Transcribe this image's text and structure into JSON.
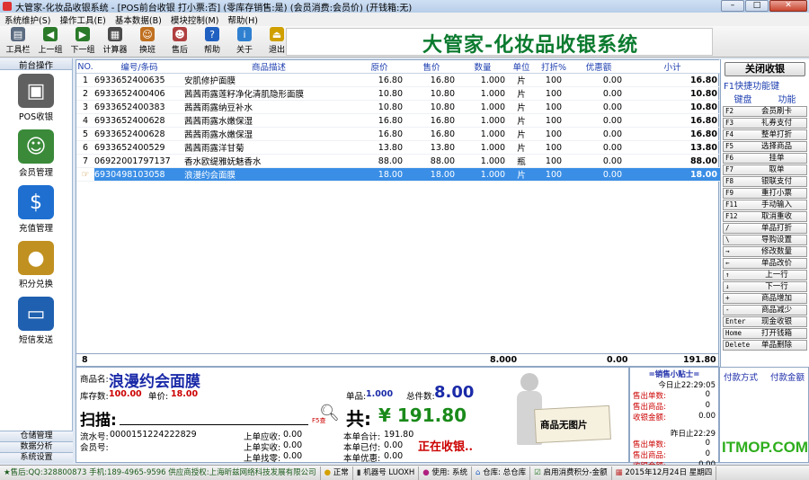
{
  "window": {
    "title": "大管家-化妆品收银系统 - [POS前台收银 打小票:否] (零库存销售:是) (会员消费:会员价) (开钱箱:无)",
    "min": "–",
    "max": "□",
    "close": "✕"
  },
  "menu": [
    "系统维护(S)",
    "操作工具(E)",
    "基本数据(B)",
    "模块控制(M)",
    "帮助(H)"
  ],
  "toolbar": {
    "buttons": [
      {
        "label": "工具栏",
        "icon": "toolbar-icon",
        "color": "#5b6b80"
      },
      {
        "label": "上一组",
        "icon": "left-arrow-icon",
        "color": "#2a7a2a"
      },
      {
        "label": "下一组",
        "icon": "right-arrow-icon",
        "color": "#2a7a2a"
      },
      {
        "label": "计算器",
        "icon": "calculator-icon",
        "color": "#4a4a4a"
      },
      {
        "label": "换班",
        "icon": "shift-icon",
        "color": "#c07020"
      },
      {
        "label": "售后",
        "icon": "service-icon",
        "color": "#b04040"
      },
      {
        "label": "帮助",
        "icon": "help-icon",
        "color": "#2060c0"
      },
      {
        "label": "关于",
        "icon": "about-icon",
        "color": "#3080d0"
      },
      {
        "label": "退出",
        "icon": "exit-icon",
        "color": "#d0a000"
      }
    ],
    "brand": "大管家-化妆品收银系统"
  },
  "leftnav": {
    "header": "前台操作",
    "items": [
      {
        "label": "POS收银",
        "icon": "pos-register-icon",
        "color": "#606060"
      },
      {
        "label": "会员管理",
        "icon": "members-icon",
        "color": "#3a8a3a"
      },
      {
        "label": "充值管理",
        "icon": "dollar-icon",
        "color": "#1e6fd0"
      },
      {
        "label": "积分兑换",
        "icon": "coins-icon",
        "color": "#c09020"
      },
      {
        "label": "短信发送",
        "icon": "computer-icon",
        "color": "#2060b0"
      }
    ],
    "bottom": [
      "仓储管理",
      "数据分析",
      "系统设置"
    ]
  },
  "table": {
    "headers": [
      "NO.",
      "编号/条码",
      "商品描述",
      "原价",
      "售价",
      "数量",
      "单位",
      "打折%",
      "优惠额",
      "小计"
    ],
    "rows": [
      [
        "1",
        "6933652400635",
        "安肌修护面膜",
        "16.80",
        "16.80",
        "1.000",
        "片",
        "100",
        "0.00",
        "16.80"
      ],
      [
        "2",
        "6933652400406",
        "茜茜雨露莲籽净化清肌隐形面膜",
        "10.80",
        "10.80",
        "1.000",
        "片",
        "100",
        "0.00",
        "10.80"
      ],
      [
        "3",
        "6933652400383",
        "茜茜雨露纳豆补水",
        "10.80",
        "10.80",
        "1.000",
        "片",
        "100",
        "0.00",
        "10.80"
      ],
      [
        "4",
        "6933652400628",
        "茜茜雨露水嫩保湿",
        "16.80",
        "16.80",
        "1.000",
        "片",
        "100",
        "0.00",
        "16.80"
      ],
      [
        "5",
        "6933652400628",
        "茜茜雨露水嫩保湿",
        "16.80",
        "16.80",
        "1.000",
        "片",
        "100",
        "0.00",
        "16.80"
      ],
      [
        "6",
        "6933652400529",
        "茜茜雨露洋甘菊",
        "13.80",
        "13.80",
        "1.000",
        "片",
        "100",
        "0.00",
        "13.80"
      ],
      [
        "7",
        "06922001797137",
        "香水欧缇雅妩魅香水",
        "88.00",
        "88.00",
        "1.000",
        "瓶",
        "100",
        "0.00",
        "88.00"
      ],
      [
        "",
        "6930498103058",
        "浪漫约会面膜",
        "18.00",
        "18.00",
        "1.000",
        "片",
        "100",
        "0.00",
        "18.00"
      ]
    ],
    "totals": {
      "count": "8",
      "qty": "8.000",
      "discount": "0.00",
      "subtotal": "191.80"
    }
  },
  "functions": {
    "close_label": "关闭收银",
    "hint": "F1快捷功能键",
    "hint_keys": "键盘",
    "hint_func": "功能",
    "keys": [
      {
        "k": "F2",
        "n": "会员刷卡"
      },
      {
        "k": "F3",
        "n": "礼券支付"
      },
      {
        "k": "F4",
        "n": "整单打折"
      },
      {
        "k": "F5",
        "n": "选择商品"
      },
      {
        "k": "F6",
        "n": "挂单"
      },
      {
        "k": "F7",
        "n": "取单"
      },
      {
        "k": "F8",
        "n": "银联支付"
      },
      {
        "k": "F9",
        "n": "重打小票"
      },
      {
        "k": "F11",
        "n": "手动输入"
      },
      {
        "k": "F12",
        "n": "取消重收"
      },
      {
        "k": "/",
        "n": "单品打折"
      },
      {
        "k": "\\",
        "n": "导购设置"
      },
      {
        "k": "→",
        "n": "修改数量"
      },
      {
        "k": "←",
        "n": "单品改价"
      },
      {
        "k": "↑",
        "n": "上一行"
      },
      {
        "k": "↓",
        "n": "下一行"
      },
      {
        "k": "+",
        "n": "商品增加"
      },
      {
        "k": "-",
        "n": "商品减少"
      },
      {
        "k": "Enter",
        "n": "现金收银"
      },
      {
        "k": "Home",
        "n": "打开钱箱"
      },
      {
        "k": "Delete",
        "n": "单品删除"
      }
    ]
  },
  "info": {
    "product_label": "商品名:",
    "product_name": "浪漫约会面膜",
    "stock_label": "库存数:",
    "stock": "100.00",
    "price_label": "单价:",
    "price": "18.00",
    "single_label": "单品:",
    "single": "1.000",
    "total_label": "总件数:",
    "total": "8.00",
    "scan_label": "扫描:",
    "scan_key": "F5查",
    "sum_label": "共:",
    "sum": "¥ 191.80",
    "serial_label": "流水号:",
    "serial": "0000151224222829",
    "member_label": "会员号:",
    "last_due_label": "上单应收:",
    "last_due": "0.00",
    "last_paid_label": "上单实收:",
    "last_paid": "0.00",
    "last_change_label": "上单找零:",
    "last_change": "0.00",
    "cur_total_label": "本单合计:",
    "cur_total": "191.80",
    "cur_paid_label": "本单已付:",
    "cur_paid": "0.00",
    "cur_disc_label": "本单优惠:",
    "cur_disc": "0.00",
    "status": "正在收银..",
    "no_image": "商品无图片"
  },
  "tip": {
    "title": "=销售小贴士=",
    "today": "今日止22:29:05",
    "yesterday": "昨日止22:29",
    "labels": [
      "售出单数:",
      "售出商品:",
      "收银金额:"
    ],
    "today_vals": [
      "0",
      "0",
      "0.00"
    ],
    "yday_vals": [
      "0",
      "0",
      "0.00"
    ]
  },
  "pay": {
    "method": "付款方式",
    "amount": "付款金额"
  },
  "statusbar": [
    "★售后:QQ:328800873 手机:189-4965-9596 供应商授权:上海昕兹网络科技发展有限公司",
    "正常",
    "机器号 LUOXH",
    "使用: 系统",
    "仓库: 总仓库",
    "启用消费积分-金额",
    "2015年12月24日 星期四"
  ],
  "watermark": "ITMOP.COM"
}
